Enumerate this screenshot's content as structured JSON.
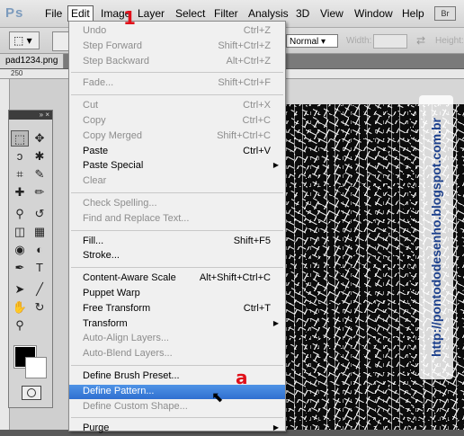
{
  "app": {
    "logo": "Ps",
    "badge": "Br"
  },
  "menubar": [
    "File",
    "Edit",
    "Image",
    "Layer",
    "Select",
    "Filter",
    "Analysis",
    "3D",
    "View",
    "Window",
    "Help"
  ],
  "options": {
    "blend_mode": "Normal",
    "width_label": "Width:",
    "height_label": "Height:"
  },
  "document": {
    "tab": "pad1234.png",
    "ruler_start": "250"
  },
  "tools_panel": {
    "header": "» ×"
  },
  "edit_menu": [
    {
      "label": "Undo",
      "shortcut": "Ctrl+Z",
      "disabled": true
    },
    {
      "label": "Step Forward",
      "shortcut": "Shift+Ctrl+Z",
      "disabled": true
    },
    {
      "label": "Step Backward",
      "shortcut": "Alt+Ctrl+Z",
      "disabled": true
    },
    {
      "sep": true
    },
    {
      "label": "Fade...",
      "shortcut": "Shift+Ctrl+F",
      "disabled": true
    },
    {
      "sep": true
    },
    {
      "label": "Cut",
      "shortcut": "Ctrl+X",
      "disabled": true
    },
    {
      "label": "Copy",
      "shortcut": "Ctrl+C",
      "disabled": true
    },
    {
      "label": "Copy Merged",
      "shortcut": "Shift+Ctrl+C",
      "disabled": true
    },
    {
      "label": "Paste",
      "shortcut": "Ctrl+V",
      "disabled": false
    },
    {
      "label": "Paste Special",
      "shortcut": "",
      "disabled": false,
      "submenu": true
    },
    {
      "label": "Clear",
      "shortcut": "",
      "disabled": true
    },
    {
      "sep": true
    },
    {
      "label": "Check Spelling...",
      "shortcut": "",
      "disabled": true
    },
    {
      "label": "Find and Replace Text...",
      "shortcut": "",
      "disabled": true
    },
    {
      "sep": true
    },
    {
      "label": "Fill...",
      "shortcut": "Shift+F5",
      "disabled": false
    },
    {
      "label": "Stroke...",
      "shortcut": "",
      "disabled": false
    },
    {
      "sep": true
    },
    {
      "label": "Content-Aware Scale",
      "shortcut": "Alt+Shift+Ctrl+C",
      "disabled": false
    },
    {
      "label": "Puppet Warp",
      "shortcut": "",
      "disabled": false
    },
    {
      "label": "Free Transform",
      "shortcut": "Ctrl+T",
      "disabled": false
    },
    {
      "label": "Transform",
      "shortcut": "",
      "disabled": false,
      "submenu": true
    },
    {
      "label": "Auto-Align Layers...",
      "shortcut": "",
      "disabled": true
    },
    {
      "label": "Auto-Blend Layers...",
      "shortcut": "",
      "disabled": true
    },
    {
      "sep": true
    },
    {
      "label": "Define Brush Preset...",
      "shortcut": "",
      "disabled": false
    },
    {
      "label": "Define Pattern...",
      "shortcut": "",
      "disabled": false,
      "highlighted": true
    },
    {
      "label": "Define Custom Shape...",
      "shortcut": "",
      "disabled": true
    },
    {
      "sep": true
    },
    {
      "label": "Purge",
      "shortcut": "",
      "disabled": false,
      "submenu": true
    }
  ],
  "annotations": {
    "step1": "1",
    "stepa": "a"
  },
  "watermark": "http://pontododesenho.blogspot.com.br",
  "tool_icons": [
    "marquee-icon",
    "move-icon",
    "lasso-icon",
    "magic-wand-icon",
    "crop-icon",
    "eyedropper-icon",
    "healing-brush-icon",
    "brush-icon",
    "clone-stamp-icon",
    "history-brush-icon",
    "eraser-icon",
    "gradient-icon",
    "blur-icon",
    "dodge-icon",
    "pen-icon",
    "type-icon",
    "path-selection-icon",
    "line-icon",
    "hand-icon",
    "rotate-view-icon",
    "zoom-icon"
  ],
  "colors": {
    "highlight": "#2f6fd0",
    "annotation": "#e0101a",
    "watermark": "#1b3f8c"
  }
}
